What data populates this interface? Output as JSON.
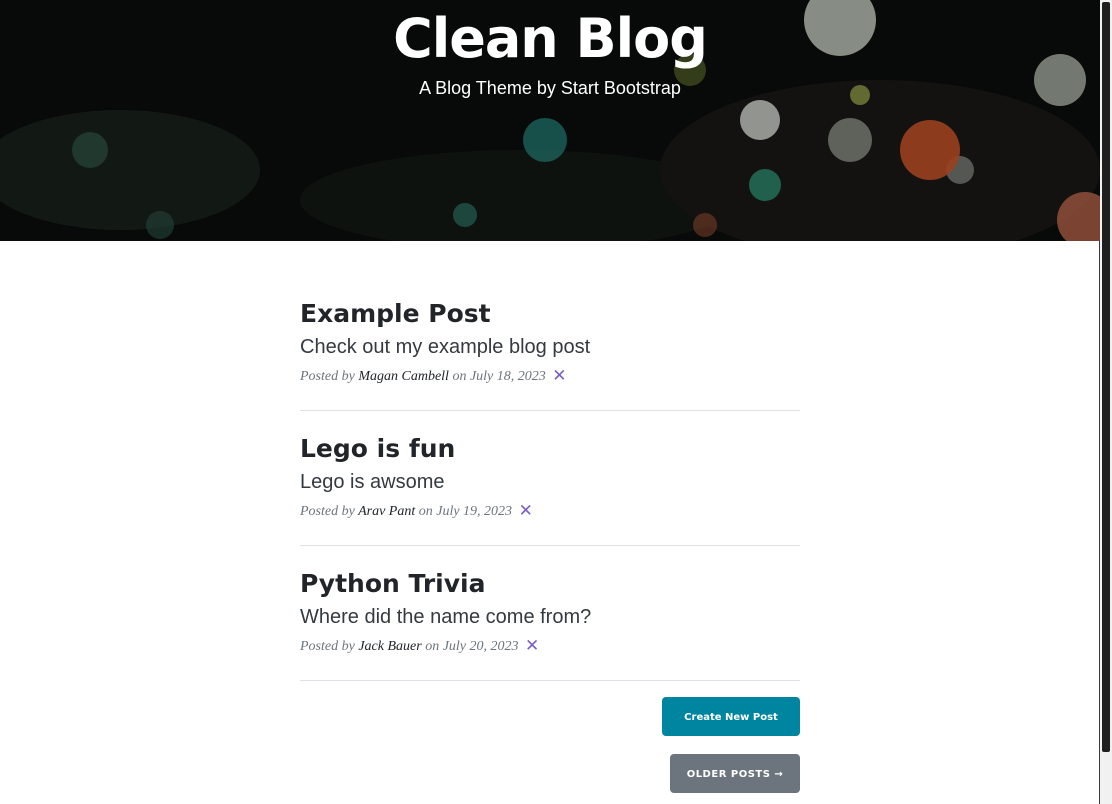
{
  "header": {
    "title": "Clean Blog",
    "subheading": "A Blog Theme by Start Bootstrap"
  },
  "posts": [
    {
      "title": "Example Post",
      "subtitle": "Check out my example blog post",
      "posted_by_label": "Posted by",
      "author": "Magan Cambell",
      "on_label": "on",
      "date": "July 18, 2023",
      "delete_symbol": "✕"
    },
    {
      "title": "Lego is fun",
      "subtitle": "Lego is awsome",
      "posted_by_label": "Posted by",
      "author": "Arav Pant",
      "on_label": "on",
      "date": "July 19, 2023",
      "delete_symbol": "✕"
    },
    {
      "title": "Python Trivia",
      "subtitle": "Where did the name come from?",
      "posted_by_label": "Posted by",
      "author": "Jack Bauer",
      "on_label": "on",
      "date": "July 20, 2023",
      "delete_symbol": "✕"
    }
  ],
  "actions": {
    "create_label": "Create New Post",
    "older_label": "OLDER POSTS →"
  },
  "colors": {
    "primary": "#0085a1",
    "secondary": "#6c757d",
    "delete": "#7b5ec6",
    "text": "#212529",
    "muted": "#6c757d"
  },
  "icons": {
    "delete": "close-icon"
  }
}
